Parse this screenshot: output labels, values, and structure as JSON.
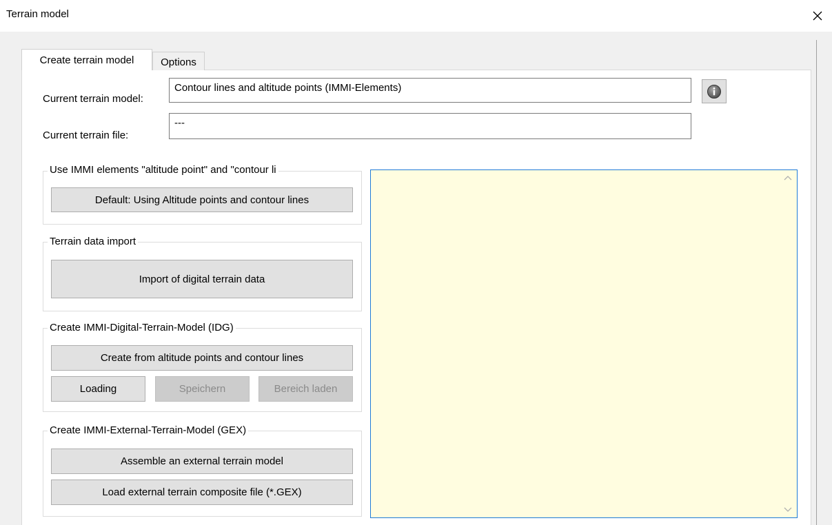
{
  "window": {
    "title": "Terrain model",
    "close_icon": "close-icon"
  },
  "tabs": [
    {
      "label": "Create terrain model",
      "selected": true
    },
    {
      "label": "Options",
      "selected": false
    }
  ],
  "fields": {
    "current_model_label": "Current terrain model:",
    "current_model_value": "Contour lines and altitude points (IMMI-Elements)",
    "current_file_label": "Current terrain file:",
    "current_file_value": "---",
    "info_icon": "info-icon"
  },
  "groups": {
    "immi_elements": {
      "legend": "Use IMMI elements \"altitude point\" and \"contour li",
      "default_button": "Default: Using Altitude points and contour lines"
    },
    "terrain_import": {
      "legend": "Terrain data import",
      "import_button": "Import of digital terrain data"
    },
    "idg": {
      "legend": "Create IMMI-Digital-Terrain-Model (IDG)",
      "create_button": "Create from altitude points and contour lines",
      "loading_button": "Loading",
      "save_button": "Speichern",
      "load_area_button": "Bereich laden"
    },
    "gex": {
      "legend": "Create IMMI-External-Terrain-Model (GEX)",
      "assemble_button": "Assemble an external terrain model",
      "load_gex_button": "Load external terrain composite file (*.GEX)"
    }
  },
  "notes": {
    "text": "",
    "background_color": "#fffde0",
    "border_color": "#1e7ad6",
    "scroll_up_icon": "chevron-up-icon",
    "scroll_down_icon": "chevron-down-icon"
  }
}
